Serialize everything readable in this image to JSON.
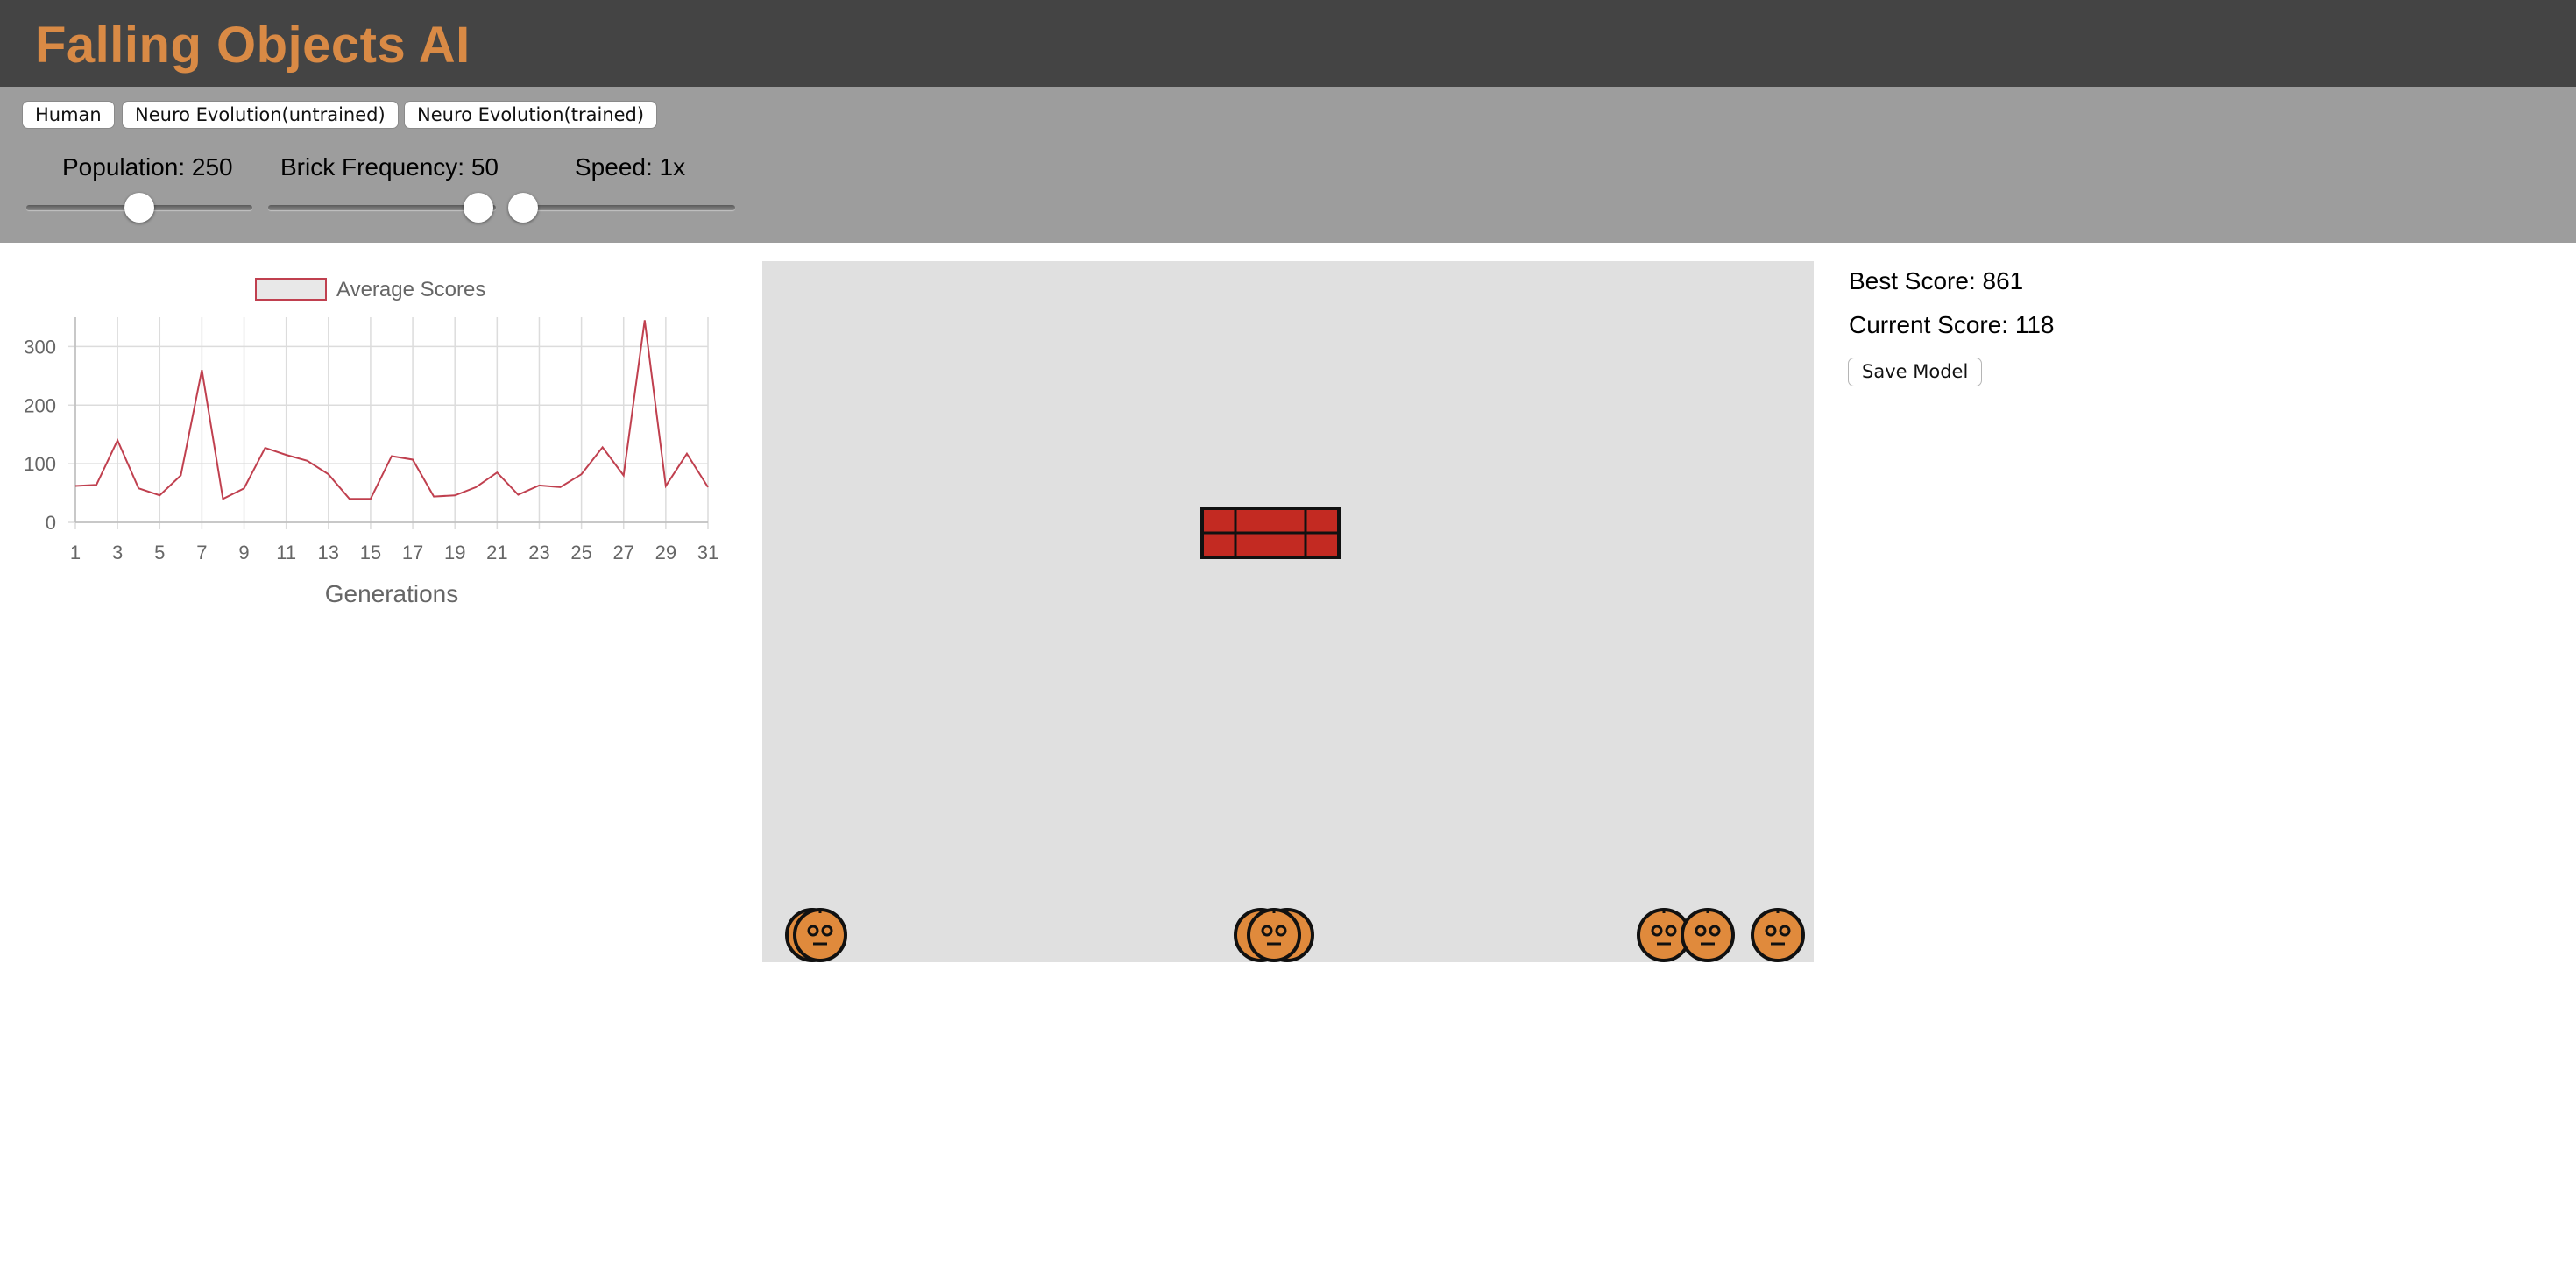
{
  "app": {
    "title": "Falling Objects AI"
  },
  "modes": [
    "Human",
    "Neuro Evolution(untrained)",
    "Neuro Evolution(trained)"
  ],
  "sliders": {
    "population": {
      "label": "Population: 250",
      "value": 250
    },
    "brick_frequency": {
      "label": "Brick Frequency: 50",
      "value": 50
    },
    "speed": {
      "label": "Speed: 1x",
      "value": 1
    }
  },
  "scores": {
    "best": "Best Score: 861",
    "current": "Current Score: 118"
  },
  "save_button": "Save Model",
  "colors": {
    "title": "#d98a45",
    "line": "#c0404f",
    "brick": "#c32a22",
    "player": "#e08a3c"
  },
  "chart_data": {
    "type": "line",
    "legend": [
      "Average Scores"
    ],
    "xlabel": "Generations",
    "ylabel": "",
    "x": [
      1,
      2,
      3,
      4,
      5,
      6,
      7,
      8,
      9,
      10,
      11,
      12,
      13,
      14,
      15,
      16,
      17,
      18,
      19,
      20,
      21,
      22,
      23,
      24,
      25,
      26,
      27,
      28,
      29,
      30,
      31
    ],
    "x_tick_labels": [
      "1",
      "3",
      "5",
      "7",
      "9",
      "11",
      "13",
      "15",
      "17",
      "19",
      "21",
      "23",
      "25",
      "27",
      "29",
      "31"
    ],
    "y_tick_labels": [
      "0",
      "100",
      "200",
      "300"
    ],
    "ylim": [
      0,
      350
    ],
    "grid": true,
    "legend_position": "top",
    "series": [
      {
        "name": "Average Scores",
        "values": [
          62,
          64,
          140,
          58,
          46,
          80,
          260,
          40,
          58,
          127,
          115,
          105,
          82,
          40,
          40,
          113,
          107,
          44,
          46,
          60,
          85,
          47,
          63,
          60,
          82,
          128,
          80,
          345,
          62,
          117,
          60
        ]
      }
    ]
  }
}
